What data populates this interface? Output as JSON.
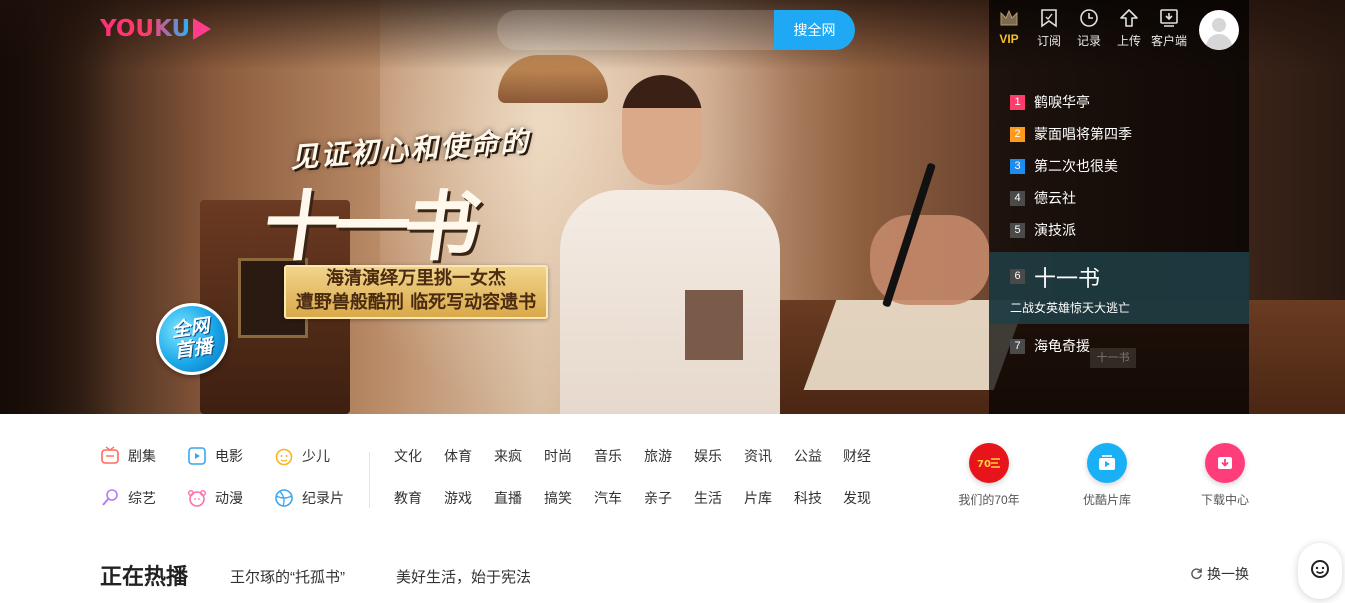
{
  "header": {
    "logo_text": "YOUKU",
    "search": {
      "value": "",
      "placeholder": "",
      "button_label": "搜全网"
    },
    "actions": [
      {
        "label": "VIP",
        "icon": "crown-icon"
      },
      {
        "label": "订阅",
        "icon": "bookmark-icon"
      },
      {
        "label": "记录",
        "icon": "clock-icon"
      },
      {
        "label": "上传",
        "icon": "upload-icon"
      },
      {
        "label": "客户端",
        "icon": "download-icon"
      }
    ],
    "avatar_icon": "user-avatar-icon"
  },
  "banner": {
    "title_top": "见证初心和使命的",
    "title_big": "十一书",
    "promo_line1": "海清演绎万里挑一女杰",
    "promo_line2": "遭野兽般酷刑 临死写动容遗书",
    "badge_line1": "全网",
    "badge_line2": "首播"
  },
  "ranking": {
    "items": [
      {
        "num": "1",
        "label": "鹤唳华亭"
      },
      {
        "num": "2",
        "label": "蒙面唱将第四季"
      },
      {
        "num": "3",
        "label": "第二次也很美"
      },
      {
        "num": "4",
        "label": "德云社"
      },
      {
        "num": "5",
        "label": "演技派"
      },
      {
        "num": "6",
        "label": "十一书",
        "sub": "二战女英雄惊天大逃亡"
      },
      {
        "num": "7",
        "label": "海龟奇援"
      }
    ],
    "ghost_label": "十一书"
  },
  "channels": {
    "main": [
      {
        "label": "剧集",
        "icon": "tv-icon",
        "color": "#ff6b5e"
      },
      {
        "label": "电影",
        "icon": "film-icon",
        "color": "#3aa6f0"
      },
      {
        "label": "少儿",
        "icon": "kids-icon",
        "color": "#ffb020"
      },
      {
        "label": "综艺",
        "icon": "microphone-icon",
        "color": "#b47cf5"
      },
      {
        "label": "动漫",
        "icon": "anime-bear-icon",
        "color": "#ff6fa8"
      },
      {
        "label": "纪录片",
        "icon": "globe-icon",
        "color": "#3aa6f0"
      }
    ],
    "sub_row1": [
      "文化",
      "体育",
      "来疯",
      "时尚",
      "音乐",
      "旅游",
      "娱乐",
      "资讯",
      "公益",
      "财经"
    ],
    "sub_row2": [
      "教育",
      "游戏",
      "直播",
      "搞笑",
      "汽车",
      "亲子",
      "生活",
      "片库",
      "科技",
      "发现"
    ],
    "quick": [
      {
        "label": "我们的70年",
        "icon": "anniversary-70-icon",
        "color": "#e8141b"
      },
      {
        "label": "优酷片库",
        "icon": "play-library-icon",
        "color": "#1ab0f5"
      },
      {
        "label": "下载中心",
        "icon": "download-center-icon",
        "color": "#ff3d7a"
      }
    ]
  },
  "now_playing": {
    "title": "正在热播",
    "tags": [
      "王尔琢的“托孤书”",
      "美好生活，始于宪法"
    ],
    "refresh_label": "换一换"
  }
}
